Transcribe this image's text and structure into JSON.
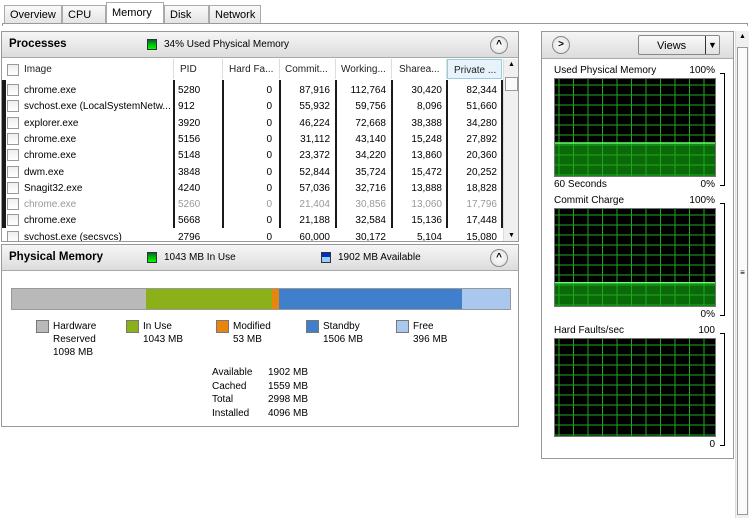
{
  "tabs": [
    {
      "label": "Overview"
    },
    {
      "label": "CPU"
    },
    {
      "label": "Memory",
      "active": true
    },
    {
      "label": "Disk"
    },
    {
      "label": "Network"
    }
  ],
  "processes": {
    "title": "Processes",
    "status": "34% Used Physical Memory",
    "columns": [
      "Image",
      "PID",
      "Hard Fa...",
      "Commit...",
      "Working...",
      "Sharea...",
      "Private ..."
    ],
    "sorted_column": "Private ...",
    "rows": [
      {
        "image": "chrome.exe",
        "pid": "5280",
        "hard": "0",
        "commit": "87,916",
        "working": "112,764",
        "shareable": "30,420",
        "private": "82,344"
      },
      {
        "image": "svchost.exe (LocalSystemNetw...",
        "pid": "912",
        "hard": "0",
        "commit": "55,932",
        "working": "59,756",
        "shareable": "8,096",
        "private": "51,660"
      },
      {
        "image": "explorer.exe",
        "pid": "3920",
        "hard": "0",
        "commit": "46,224",
        "working": "72,668",
        "shareable": "38,388",
        "private": "34,280"
      },
      {
        "image": "chrome.exe",
        "pid": "5156",
        "hard": "0",
        "commit": "31,112",
        "working": "43,140",
        "shareable": "15,248",
        "private": "27,892"
      },
      {
        "image": "chrome.exe",
        "pid": "5148",
        "hard": "0",
        "commit": "23,372",
        "working": "34,220",
        "shareable": "13,860",
        "private": "20,360"
      },
      {
        "image": "dwm.exe",
        "pid": "3848",
        "hard": "0",
        "commit": "52,844",
        "working": "35,724",
        "shareable": "15,472",
        "private": "20,252"
      },
      {
        "image": "Snagit32.exe",
        "pid": "4240",
        "hard": "0",
        "commit": "57,036",
        "working": "32,716",
        "shareable": "13,888",
        "private": "18,828"
      },
      {
        "image": "chrome.exe",
        "pid": "5260",
        "hard": "0",
        "commit": "21,404",
        "working": "30,856",
        "shareable": "13,060",
        "private": "17,796",
        "dimmed": true
      },
      {
        "image": "chrome.exe",
        "pid": "5668",
        "hard": "0",
        "commit": "21,188",
        "working": "32,584",
        "shareable": "15,136",
        "private": "17,448"
      },
      {
        "image": "svchost.exe (secsvcs)",
        "pid": "2796",
        "hard": "0",
        "commit": "60,000",
        "working": "30,172",
        "shareable": "5,104",
        "private": "15,080"
      }
    ]
  },
  "physical_memory": {
    "title": "Physical Memory",
    "in_use_label": "1043 MB In Use",
    "available_label": "1902 MB Available",
    "segments": [
      {
        "name": "Hardware Reserved",
        "value": "1098 MB",
        "mb": 1098,
        "color": "#b9b9b9"
      },
      {
        "name": "In Use",
        "value": "1043 MB",
        "mb": 1043,
        "color": "#8cb01a"
      },
      {
        "name": "Modified",
        "value": "53 MB",
        "mb": 53,
        "color": "#e8860c"
      },
      {
        "name": "Standby",
        "value": "1506 MB",
        "mb": 1506,
        "color": "#3f7fcc"
      },
      {
        "name": "Free",
        "value": "396 MB",
        "mb": 396,
        "color": "#aac8ee"
      }
    ],
    "summary": [
      {
        "label": "Available",
        "value": "1902 MB"
      },
      {
        "label": "Cached",
        "value": "1559 MB"
      },
      {
        "label": "Total",
        "value": "2998 MB"
      },
      {
        "label": "Installed",
        "value": "4096 MB"
      }
    ]
  },
  "side": {
    "views_label": "Views",
    "graphs": [
      {
        "title": "Used Physical Memory",
        "max": "100%",
        "min": "0%",
        "footer": "60 Seconds",
        "level_percent": 34
      },
      {
        "title": "Commit Charge",
        "max": "100%",
        "min": "0%",
        "footer": "",
        "level_percent": 24
      },
      {
        "title": "Hard Faults/sec",
        "max": "100",
        "min": "0",
        "footer": "",
        "level_percent": 0
      }
    ]
  }
}
